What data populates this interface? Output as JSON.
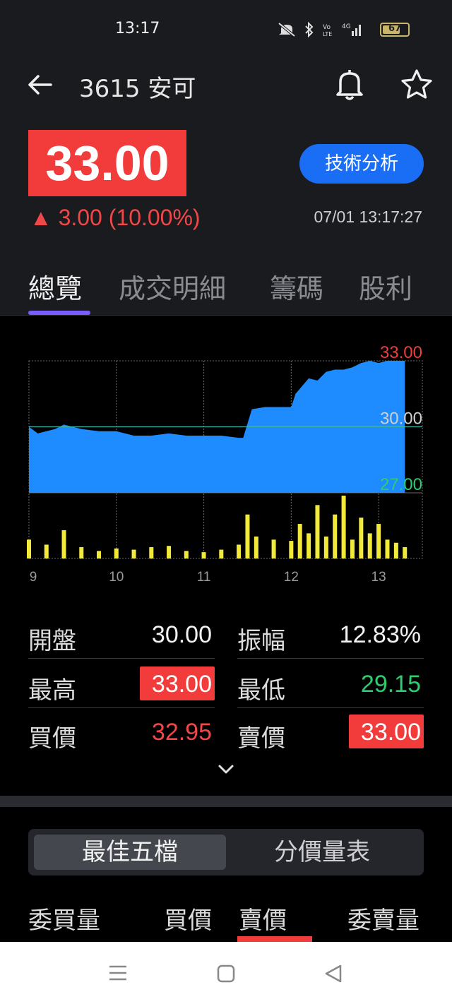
{
  "status_bar": {
    "time": "13:17",
    "battery": "67"
  },
  "header": {
    "title": "3615 安可"
  },
  "quote": {
    "price": "33.00",
    "change": "▲ 3.00 (10.00%)",
    "datetime": "07/01 13:17:27",
    "tech_button": "技術分析"
  },
  "tabs": [
    {
      "label": "總覽"
    },
    {
      "label": "成交明細"
    },
    {
      "label": "籌碼"
    },
    {
      "label": "股利"
    }
  ],
  "chart_data": {
    "type": "area",
    "y_tick_labels": [
      "33.00",
      "30.00",
      "27.00"
    ],
    "x_tick_labels": [
      "9",
      "10",
      "11",
      "12",
      "13"
    ],
    "ylim": [
      27.0,
      33.0
    ],
    "reference_price": 30.0,
    "price_series": {
      "x": [
        9.0,
        9.1,
        9.2,
        9.3,
        9.4,
        9.6,
        9.8,
        10.0,
        10.2,
        10.4,
        10.6,
        10.8,
        11.0,
        11.2,
        11.4,
        11.45,
        11.55,
        11.7,
        11.8,
        12.0,
        12.05,
        12.2,
        12.3,
        12.4,
        12.5,
        12.6,
        12.7,
        12.8,
        12.9,
        13.0,
        13.1,
        13.2,
        13.3
      ],
      "y": [
        30.0,
        29.7,
        29.8,
        29.9,
        30.1,
        29.9,
        29.8,
        29.8,
        29.6,
        29.6,
        29.7,
        29.6,
        29.6,
        29.6,
        29.5,
        29.5,
        30.8,
        30.9,
        30.9,
        30.9,
        31.5,
        32.2,
        32.1,
        32.5,
        32.6,
        32.6,
        32.7,
        32.9,
        33.0,
        32.9,
        33.0,
        33.0,
        33.0
      ]
    },
    "volume_series": {
      "x": [
        9.0,
        9.2,
        9.4,
        9.6,
        9.8,
        10.0,
        10.2,
        10.4,
        10.6,
        10.8,
        11.0,
        11.2,
        11.4,
        11.5,
        11.6,
        11.8,
        12.0,
        12.1,
        12.2,
        12.3,
        12.4,
        12.5,
        12.6,
        12.7,
        12.8,
        12.9,
        13.0,
        13.1,
        13.2,
        13.3
      ],
      "y": [
        30,
        22,
        45,
        18,
        12,
        16,
        14,
        18,
        20,
        12,
        10,
        14,
        22,
        70,
        35,
        30,
        28,
        55,
        40,
        85,
        35,
        70,
        100,
        30,
        65,
        40,
        55,
        30,
        25,
        18
      ]
    }
  },
  "stats": {
    "open_label": "開盤",
    "open_value": "30.00",
    "amplitude_label": "振幅",
    "amplitude_value": "12.83%",
    "high_label": "最高",
    "high_value": "33.00",
    "low_label": "最低",
    "low_value": "29.15",
    "bid_label": "買價",
    "bid_value": "32.95",
    "ask_label": "賣價",
    "ask_value": "33.00"
  },
  "order_book": {
    "segments": [
      "最佳五檔",
      "分價量表"
    ],
    "columns": [
      "委買量",
      "買價",
      "賣價",
      "委賣量"
    ]
  },
  "colors": {
    "up": "#f23c3c",
    "down": "#2ecc71",
    "area": "#1e8cff",
    "volume": "#f2ea3a",
    "accent": "#7a5cff",
    "button": "#1a6ef5"
  }
}
